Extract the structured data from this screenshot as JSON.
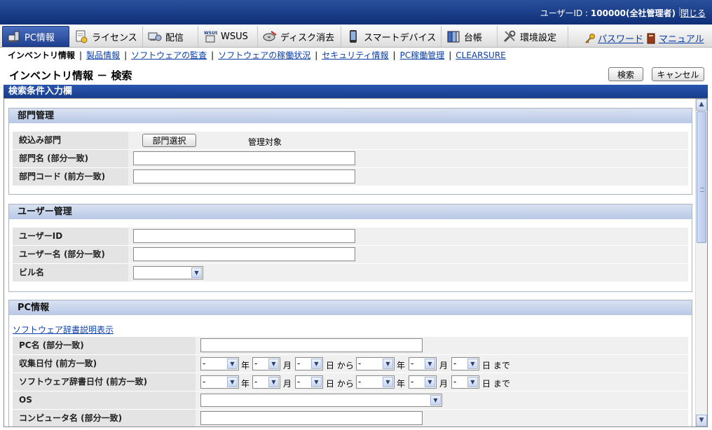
{
  "header": {
    "user_label": "ユーザーID : ",
    "user_value": "100000(全社管理者)",
    "logout": "閉じる"
  },
  "main_tabs": [
    {
      "label": "PC情報",
      "icon": "pc-icon",
      "active": true
    },
    {
      "label": "ライセンス",
      "icon": "license-icon"
    },
    {
      "label": "配信",
      "icon": "distribution-icon"
    },
    {
      "label": "WSUS",
      "icon": "wsus-icon"
    },
    {
      "label": "ディスク消去",
      "icon": "disk-erase-icon"
    },
    {
      "label": "スマートデバイス",
      "icon": "smartphone-icon"
    },
    {
      "label": "台帳",
      "icon": "ledger-icon"
    },
    {
      "label": "環境設定",
      "icon": "tools-icon"
    }
  ],
  "right_links": {
    "password": "パスワード",
    "manual": "マニュアル"
  },
  "sub_nav": [
    "インベントリ情報",
    "製品情報",
    "ソフトウェアの監査",
    "ソフトウェアの稼働状況",
    "セキュリティ情報",
    "PC稼働管理",
    "CLEARSURE"
  ],
  "page": {
    "title": "インベントリ情報 － 検索",
    "search_button": "検索",
    "cancel_button": "キャンセル",
    "section_title": "検索条件入力欄"
  },
  "dept_group": {
    "title": "部門管理",
    "narrow_label": "絞込み部門",
    "select_button": "部門選択",
    "managed_text": "管理対象",
    "name_label": "部門名 (部分一致)",
    "code_label": "部門コード (前方一致)"
  },
  "user_group": {
    "title": "ユーザー管理",
    "id_label": "ユーザーID",
    "name_label": "ユーザー名 (部分一致)",
    "building_label": "ビル名"
  },
  "pc_group": {
    "title": "PC情報",
    "dict_link": "ソフトウェア辞書説明表示",
    "pc_name_label": "PC名 (部分一致)",
    "collect_label": "収集日付 (前方一致)",
    "dict_date_label": "ソフトウェア辞書日付 (前方一致)",
    "os_label": "OS",
    "computer_label": "コンピュータ名 (部分一致)",
    "select_value": "-",
    "year": "年",
    "month": "月",
    "day_from": "日 から",
    "day_to": "日 まで"
  }
}
